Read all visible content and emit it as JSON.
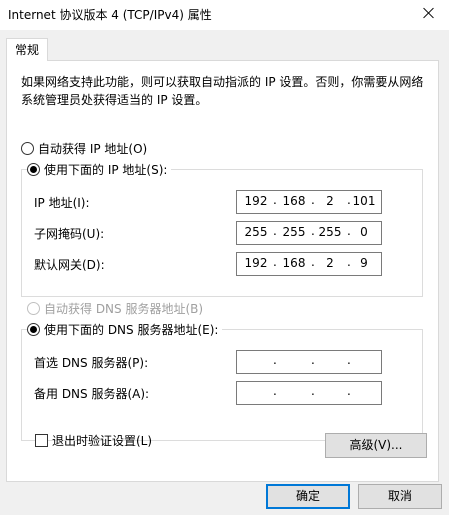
{
  "window": {
    "title": "Internet 协议版本 4 (TCP/IPv4) 属性"
  },
  "tabs": [
    {
      "label": "常规"
    }
  ],
  "general": {
    "description": "如果网络支持此功能，则可以获取自动指派的 IP 设置。否则，你需要从网络系统管理员处获得适当的 IP 设置。",
    "ip_auto_label": "自动获得 IP 地址(O)",
    "ip_manual_label": "使用下面的 IP 地址(S):",
    "ip_address_label": "IP 地址(I):",
    "subnet_mask_label": "子网掩码(U):",
    "gateway_label": "默认网关(D):",
    "ip_address": [
      "192",
      "168",
      "2",
      "101"
    ],
    "subnet_mask": [
      "255",
      "255",
      "255",
      "0"
    ],
    "gateway": [
      "192",
      "168",
      "2",
      "9"
    ],
    "dns_auto_label": "自动获得 DNS 服务器地址(B)",
    "dns_manual_label": "使用下面的 DNS 服务器地址(E):",
    "preferred_dns_label": "首选 DNS 服务器(P):",
    "alternate_dns_label": "备用 DNS 服务器(A):",
    "preferred_dns": [
      "",
      "",
      "",
      ""
    ],
    "alternate_dns": [
      "",
      "",
      "",
      ""
    ],
    "validate_label": "退出时验证设置(L)",
    "advanced_label": "高级(V)..."
  },
  "buttons": {
    "ok": "确定",
    "cancel": "取消"
  },
  "state": {
    "ip_mode": "manual",
    "dns_mode": "manual",
    "dns_auto_disabled": true,
    "validate_checked": false
  },
  "colors": {
    "default_button_border": "#0078d7",
    "dialog_bg": "#f0f0f0"
  }
}
